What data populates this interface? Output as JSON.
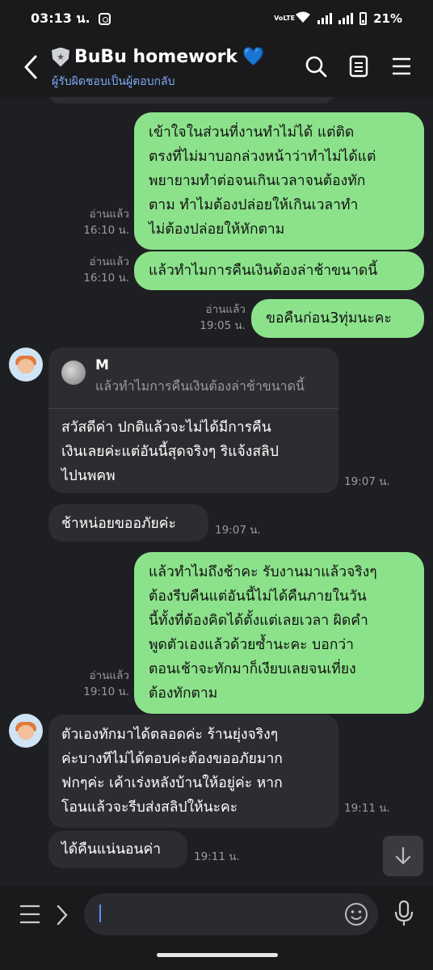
{
  "status": {
    "time": "03:13 น.",
    "battery": "21%",
    "volte": "VoLTE"
  },
  "header": {
    "title": "BuBu homework",
    "subtitle": "ผู้รับผิดชอบเป็นผู้ตอบกลับ"
  },
  "messages": [
    {
      "side": "mine",
      "lines": [
        "เข้าใจในส่วนที่งานทำไม่ได้  แต่ติด",
        "ตรงที่ไม่มาบอกล่วงหน้าว่าทำไม่ได้แต่",
        "พยายามทำต่อจนเกินเวลาจนต้องทัก",
        "ตาม  ทำไมต้องปล่อยให้เกินเวลาทำ",
        "ไม่ต้องปล่อยให้หักตาม"
      ],
      "read": "อ่านแล้ว",
      "time": "16:10 น."
    },
    {
      "side": "mine",
      "lines": [
        "แล้วทำไมการคืนเงินต้องล่าช้าขนาดนี้"
      ],
      "read": "อ่านแล้ว",
      "time": "16:10 น."
    },
    {
      "side": "mine",
      "lines": [
        "ขอคืนก่อน3ทุ่มนะคะ"
      ],
      "read": "อ่านแล้ว",
      "time": "19:05 น."
    },
    {
      "side": "theirs",
      "reply_name": "M",
      "reply_text": "แล้วทำไมการคืนเงินต้องล่าช้าขนาดนี้",
      "lines": [
        "สวัสดีค่า ปกติแล้วจะไม่ได้มีการคืน",
        "เงินเลยค่ะแต่อันนี้สุดจริงๆ ริแจ้งสลิป",
        "ไปนพคพ"
      ],
      "time": "19:07 น."
    },
    {
      "side": "theirs",
      "lines": [
        "ช้าหน่อยขออภัยค่ะ"
      ],
      "time": "19:07 น."
    },
    {
      "side": "mine",
      "lines": [
        "แล้วทำไมถึงช้าคะ  รับงานมาแล้วจริงๆ",
        "ต้องรีบคืนแต่อันนี้ไม่ได้คืนภายในวัน",
        "นี้ทั้งที่ต้องคิดได้ตั้งแต่เลยเวลา ผิดคำ",
        "พูดตัวเองแล้วด้วยซ้ำนะคะ  บอกว่า",
        "ตอนเช้าจะทักมาก็เงียบเลยจนเที่ยง",
        "ต้องทักตาม"
      ],
      "read": "อ่านแล้ว",
      "time": "19:10 น."
    },
    {
      "side": "theirs",
      "lines": [
        "ตัวเองทักมาได้ตลอดค่ะ ร้านยุ่งจริงๆ",
        "ค่ะบางทีไม่ได้ตอบค่ะต้องขออภัยมาก",
        "ฟกๆค่ะ เค้าเร่งหลังบ้านให้อยู่ค่ะ หาก",
        "โอนแล้วจะรีบส่งสลิปให้นะคะ"
      ],
      "time": "19:11 น."
    },
    {
      "side": "theirs",
      "lines": [
        "ได้คืนแน่นอนค่า"
      ],
      "time": "19:11 น."
    }
  ],
  "colors": {
    "mine_bubble": "#8ce28b",
    "theirs_bubble": "#2c2d30",
    "background": "#1e1f22",
    "subtitle": "#7eaaf7",
    "accent": "#5b8cff"
  },
  "icons": [
    "back-arrow-icon",
    "shield-icon",
    "blue-heart-icon",
    "search-icon",
    "notes-icon",
    "menu-icon",
    "scroll-down-icon",
    "hamburger-icon",
    "chevron-right-icon",
    "emoji-icon",
    "microphone-icon"
  ]
}
